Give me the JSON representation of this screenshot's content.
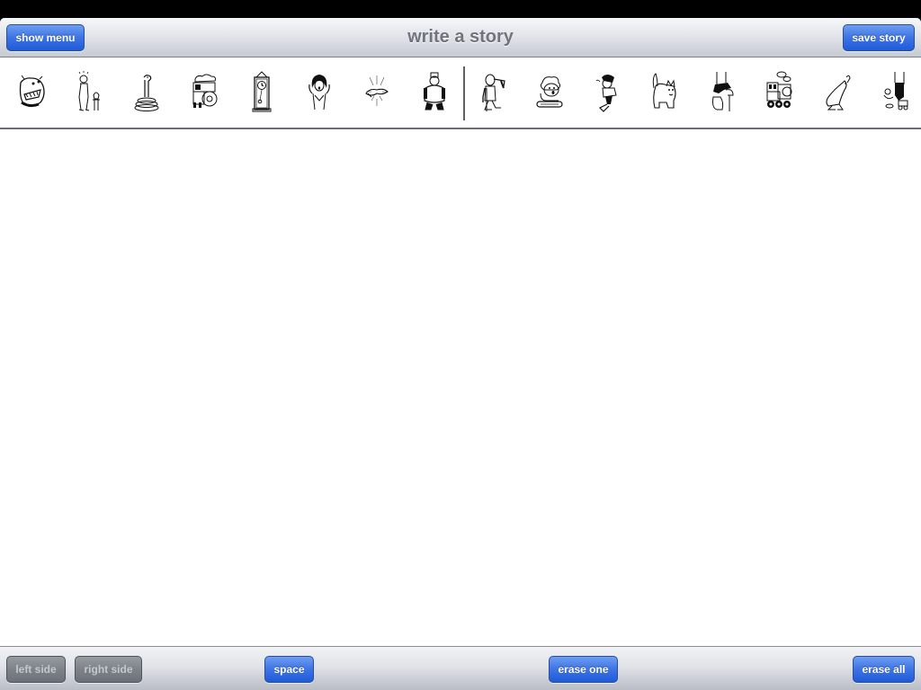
{
  "nav": {
    "title": "write a story",
    "show_menu_label": "show menu",
    "save_story_label": "save story"
  },
  "picture_strip": {
    "items": [
      {
        "name": "bulldog",
        "icon": "bulldog-icon"
      },
      {
        "name": "man-with-pedestal",
        "icon": "man-icon"
      },
      {
        "name": "snake",
        "icon": "snake-icon"
      },
      {
        "name": "steam-car",
        "icon": "steam-car-icon"
      },
      {
        "name": "grandfather-clock",
        "icon": "clock-icon"
      },
      {
        "name": "frightened-woman",
        "icon": "woman-icon"
      },
      {
        "name": "snap-spark",
        "icon": "spark-icon"
      },
      {
        "name": "king",
        "icon": "king-icon"
      },
      {
        "name": "walking-man",
        "icon": "walking-man-icon"
      },
      {
        "name": "lamb-on-log",
        "icon": "lamb-icon"
      },
      {
        "name": "running-boy",
        "icon": "running-boy-icon"
      },
      {
        "name": "cat",
        "icon": "cat-icon"
      },
      {
        "name": "boot-on-stool",
        "icon": "boot-icon"
      },
      {
        "name": "train",
        "icon": "train-icon"
      },
      {
        "name": "seal",
        "icon": "seal-icon"
      },
      {
        "name": "leg-with-toys",
        "icon": "toys-icon"
      }
    ]
  },
  "bottom": {
    "left_side_label": "left side",
    "right_side_label": "right side",
    "space_label": "space",
    "erase_one_label": "erase one",
    "erase_all_label": "erase all"
  },
  "colors": {
    "button_blue": "#3d73e4",
    "button_disabled": "#7e838a",
    "title_gray": "#6f747d"
  }
}
